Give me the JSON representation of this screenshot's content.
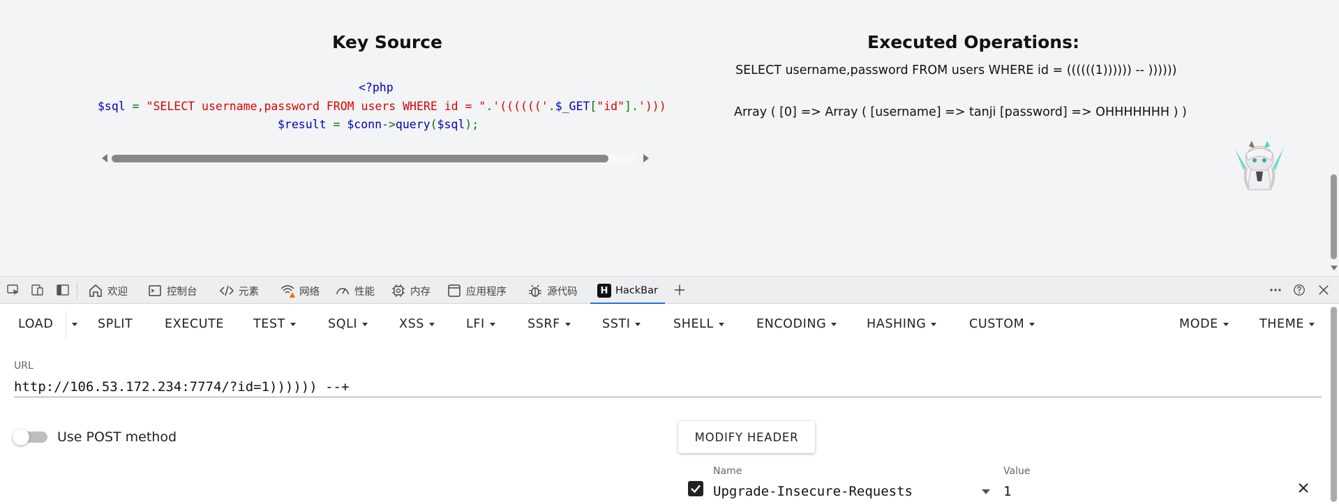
{
  "page": {
    "key_source_title": "Key Source",
    "executed_title": "Executed Operations:",
    "code": {
      "line1": "<?php",
      "line2_var": "$sql",
      "line2_eq": " = ",
      "line2_str1": "\"SELECT username,password FROM users WHERE id = \"",
      "line2_dot1": ".",
      "line2_str2": "'(((((('",
      "line2_dot2": ".",
      "line2_get": "$_GET",
      "line2_bracket_open": "[",
      "line2_key": "\"id\"",
      "line2_bracket_close": "]",
      "line2_dot3": ".",
      "line2_str3": "')))",
      "line3_var": "$result",
      "line3_eq": " = ",
      "line3_conn": "$conn",
      "line3_arrow": "->",
      "line3_fn": "query",
      "line3_open": "(",
      "line3_arg": "$sql",
      "line3_close": ");"
    },
    "executed_query": "SELECT username,password FROM users WHERE id = ((((((1)))))) -- ))))))",
    "executed_result": "Array ( [0] => Array ( [username] => tanji [password] => OHHHHHHH ) )"
  },
  "devtools": {
    "tabs": [
      {
        "label": "欢迎",
        "icon": "home-icon"
      },
      {
        "label": "控制台",
        "icon": "console-icon"
      },
      {
        "label": "元素",
        "icon": "code-icon"
      },
      {
        "label": "网络",
        "icon": "wifi-warning-icon"
      },
      {
        "label": "性能",
        "icon": "gauge-icon"
      },
      {
        "label": "内存",
        "icon": "chip-icon"
      },
      {
        "label": "应用程序",
        "icon": "app-icon"
      },
      {
        "label": "源代码",
        "icon": "bug-icon"
      },
      {
        "label": "HackBar",
        "icon": "hackbar-icon"
      }
    ],
    "hackbar_logo": "H",
    "active_tab": "HackBar",
    "accent_color": "#1a73e8"
  },
  "hackbar": {
    "menu": {
      "load": "LOAD",
      "split": "SPLIT",
      "execute": "EXECUTE",
      "test": "TEST",
      "sqli": "SQLI",
      "xss": "XSS",
      "lfi": "LFI",
      "ssrf": "SSRF",
      "ssti": "SSTI",
      "shell": "SHELL",
      "encoding": "ENCODING",
      "hashing": "HASHING",
      "custom": "CUSTOM",
      "mode": "MODE",
      "theme": "THEME"
    },
    "url_label": "URL",
    "url_value": "http://106.53.172.234:7774/?id=1)))))) --+",
    "post_method_label": "Use POST method",
    "post_method_enabled": false,
    "modify_header_label": "MODIFY HEADER",
    "header": {
      "name_label": "Name",
      "name": "Upgrade-Insecure-Requests",
      "value_label": "Value",
      "value": "1",
      "enabled": true
    }
  }
}
